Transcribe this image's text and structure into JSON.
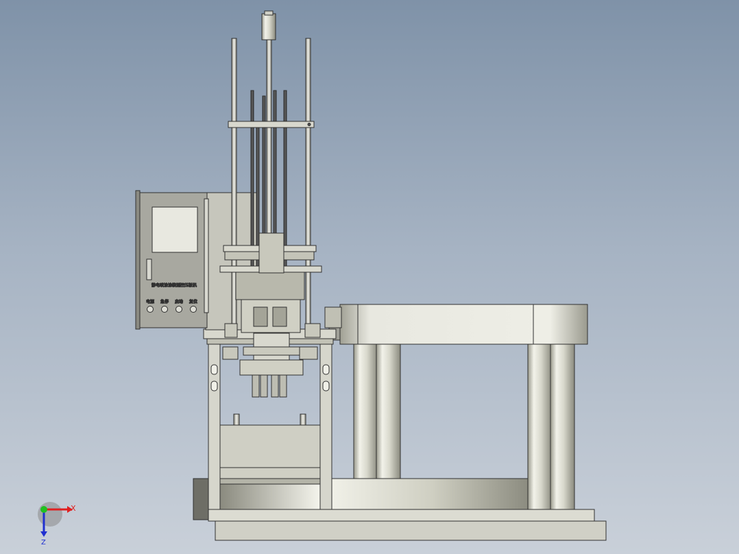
{
  "panel": {
    "title": "静电喷涂涂装测控压板机",
    "buttons": [
      "电源",
      "急停",
      "启动",
      "复位"
    ]
  },
  "triad": {
    "x_label": "X",
    "z_label": "Z",
    "x_color": "#e02020",
    "y_color": "#20c020",
    "z_color": "#2030d0"
  },
  "colors": {
    "steel_light": "#e6e6dc",
    "steel_mid": "#c8c8b8",
    "steel_dark": "#8c8c80",
    "outline": "#303030",
    "panel_face": "#a8a8a0",
    "screen": "#e8e8e0"
  }
}
